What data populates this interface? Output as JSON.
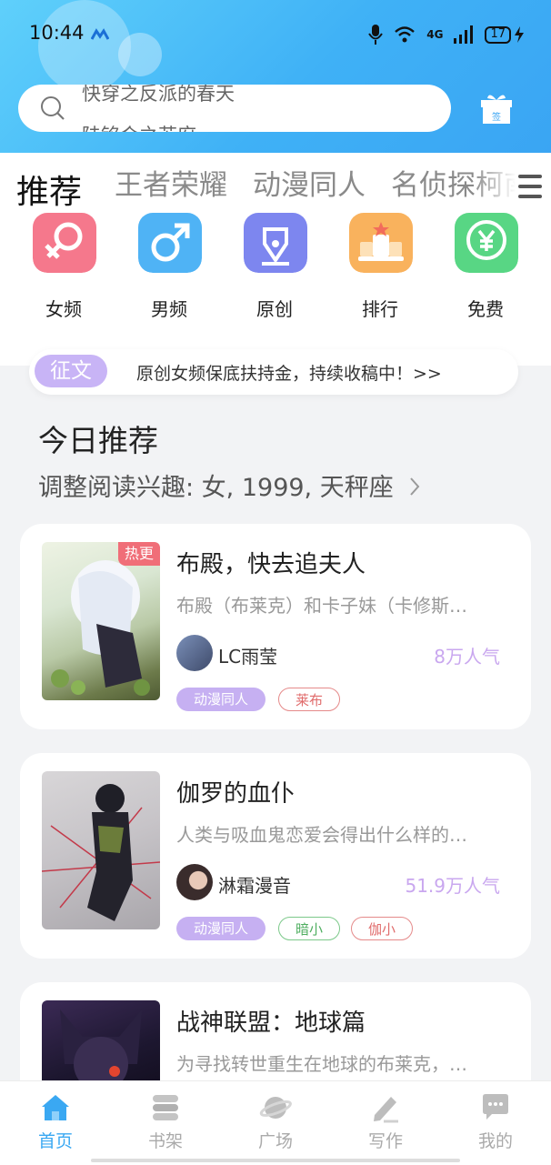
{
  "status_bar": {
    "time": "10:44",
    "battery": "17",
    "network": "4G"
  },
  "search": {
    "lines": [
      "快穿之反派的春天",
      "陆铭会之苏府"
    ]
  },
  "tabs": [
    "推荐",
    "王者荣耀",
    "动漫同人",
    "名侦探柯南"
  ],
  "categories": [
    {
      "label": "女频",
      "icon": "female-icon",
      "color": "#f5788c"
    },
    {
      "label": "男频",
      "icon": "male-icon",
      "color": "#4fb3f5"
    },
    {
      "label": "原创",
      "icon": "pen-nib-icon",
      "color": "#7d86ef"
    },
    {
      "label": "排行",
      "icon": "podium-icon",
      "color": "#f9b25d"
    },
    {
      "label": "免费",
      "icon": "yuen-coin-icon",
      "color": "#58d684"
    }
  ],
  "banner": {
    "tag": "征文",
    "text": "原创女频保底扶持金，持续收稿中！>>"
  },
  "section": {
    "title": "今日推荐",
    "subtitle": "调整阅读兴趣: 女, 1999, 天秤座"
  },
  "books": [
    {
      "title": "布殿，快去追夫人",
      "desc": "布殿（布莱克）和卡子妹（卡修斯…",
      "author": "LC雨莹",
      "popularity": "8万人气",
      "badge": "热更",
      "tags": [
        {
          "text": "动漫同人",
          "style": "solid"
        },
        {
          "text": "莱布",
          "style": "red"
        }
      ]
    },
    {
      "title": "伽罗的血仆",
      "desc": "人类与吸血鬼恋爱会得出什么样的…",
      "author": "淋霜漫音",
      "popularity": "51.9万人气",
      "badge": "",
      "tags": [
        {
          "text": "动漫同人",
          "style": "solid"
        },
        {
          "text": "暗小",
          "style": "green"
        },
        {
          "text": "伽小",
          "style": "red"
        }
      ]
    },
    {
      "title": "战神联盟：地球篇",
      "desc": "为寻找转世重生在地球的布莱克，…",
      "author": "",
      "popularity": "",
      "badge": "",
      "tags": []
    }
  ],
  "bottom_nav": [
    {
      "label": "首页",
      "icon": "home-icon",
      "active": true
    },
    {
      "label": "书架",
      "icon": "bookshelf-icon",
      "active": false
    },
    {
      "label": "广场",
      "icon": "planet-icon",
      "active": false
    },
    {
      "label": "写作",
      "icon": "pen-icon",
      "active": false
    },
    {
      "label": "我的",
      "icon": "chat-bubble-icon",
      "active": false
    }
  ],
  "colors": {
    "header": "#3fb1f6",
    "accent": "#3aa8f2",
    "tag_purple": "#c6b0f2",
    "popularity": "#c9a7ef"
  }
}
